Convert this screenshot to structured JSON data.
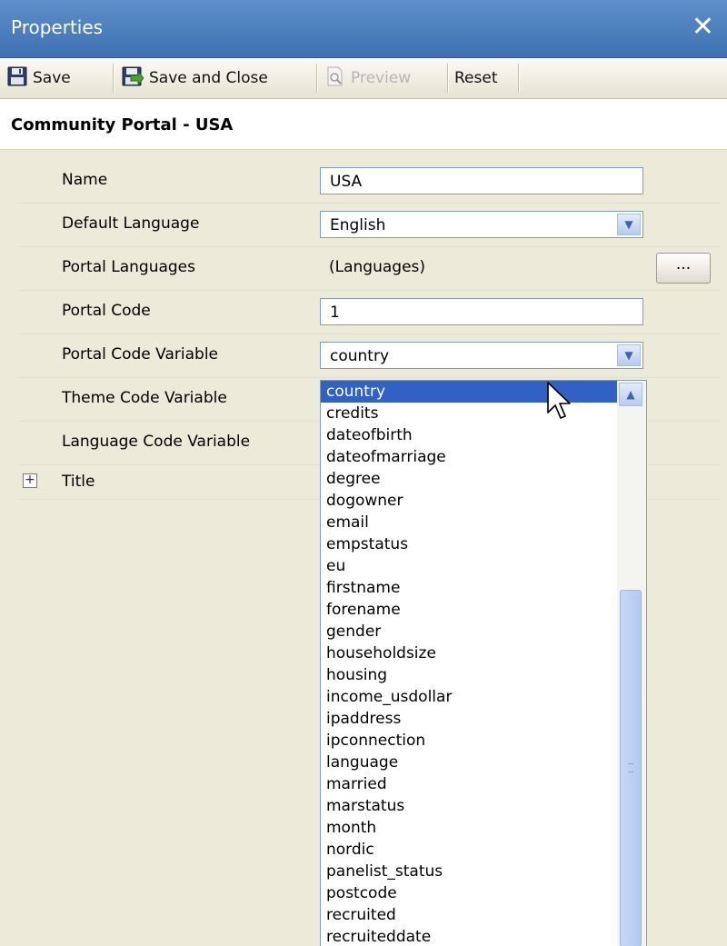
{
  "window": {
    "title": "Properties",
    "close_glyph": "✕"
  },
  "toolbar": {
    "save_label": "Save",
    "save_close_label": "Save and Close",
    "preview_label": "Preview",
    "reset_label": "Reset"
  },
  "header": {
    "title": "Community Portal - USA"
  },
  "properties": {
    "name_label": "Name",
    "name_value": "USA",
    "default_language_label": "Default Language",
    "default_language_value": "English",
    "portal_languages_label": "Portal Languages",
    "portal_languages_value": "(Languages)",
    "portal_languages_button": "...",
    "portal_code_label": "Portal Code",
    "portal_code_value": "1",
    "portal_code_variable_label": "Portal Code Variable",
    "portal_code_variable_value": "country",
    "theme_code_variable_label": "Theme Code Variable",
    "language_code_variable_label": "Language Code Variable",
    "title_label": "Title",
    "expander_glyph": "+"
  },
  "dropdown": {
    "selected": "country",
    "options": [
      "country",
      "credits",
      "dateofbirth",
      "dateofmarriage",
      "degree",
      "dogowner",
      "email",
      "empstatus",
      "eu",
      "firstname",
      "forename",
      "gender",
      "householdsize",
      "housing",
      "income_usdollar",
      "ipaddress",
      "ipconnection",
      "language",
      "married",
      "marstatus",
      "month",
      "nordic",
      "panelist_status",
      "postcode",
      "recruited",
      "recruiteddate"
    ]
  },
  "icons": {
    "save": "floppy-disk-icon",
    "save_close": "save-and-close-icon",
    "preview": "magnifier-page-icon",
    "close": "close-icon",
    "dropdown_arrow": "chevron-down-icon",
    "scroll_up": "chevron-up-icon"
  }
}
